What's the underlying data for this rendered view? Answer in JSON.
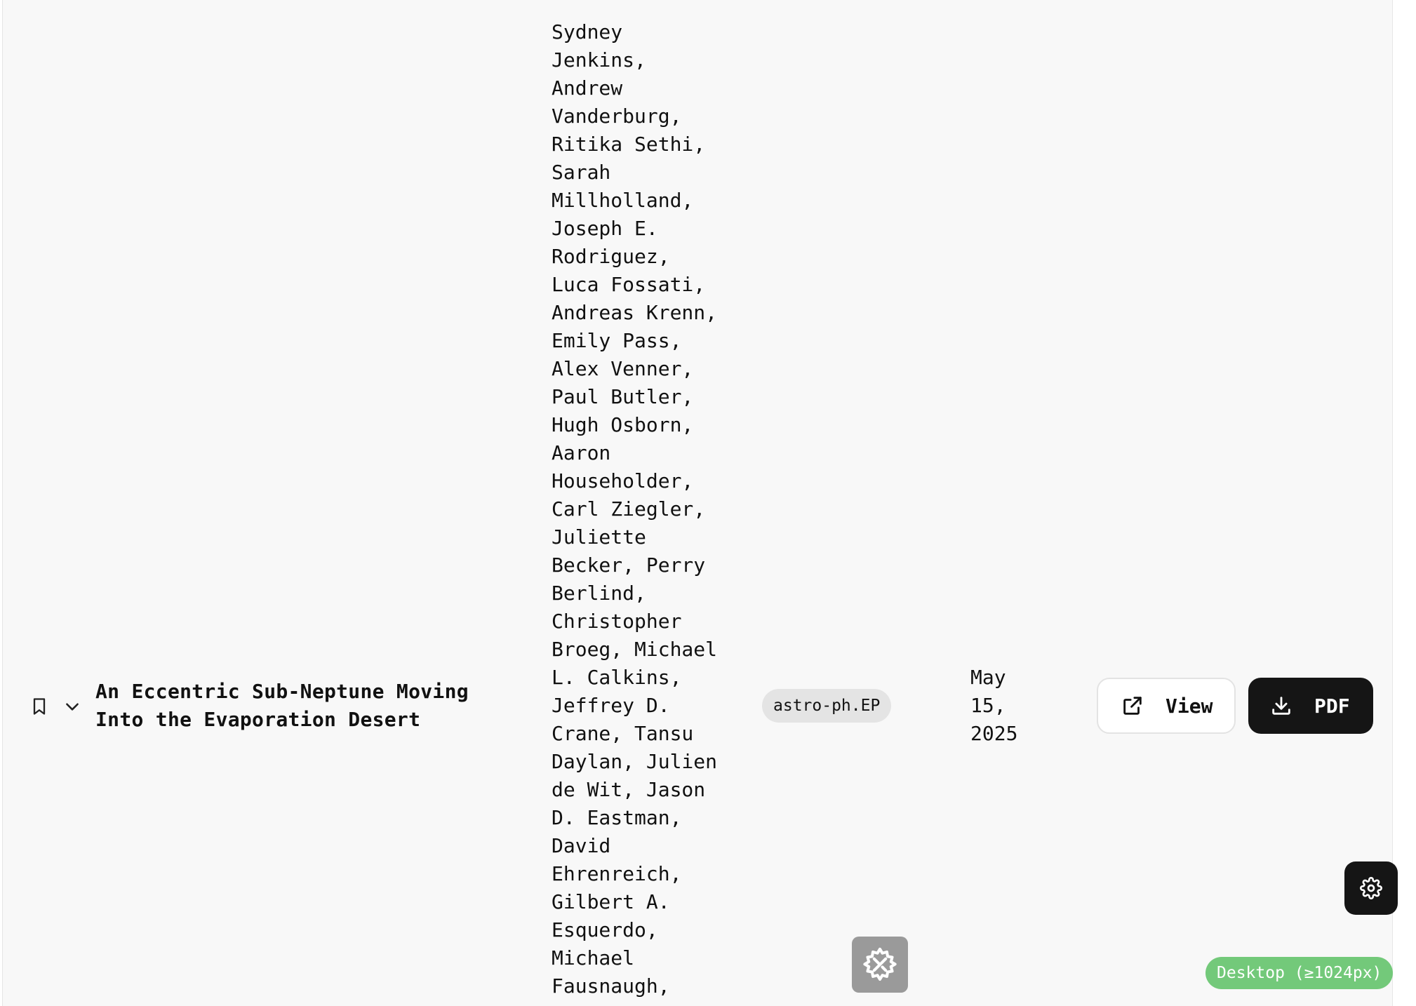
{
  "paper": {
    "title": "An Eccentric Sub-Neptune Moving Into the Evaporation Desert",
    "authors": "Sydney Jenkins, Andrew Vanderburg, Ritika Sethi, Sarah Millholland, Joseph E. Rodriguez, Luca Fossati, Andreas Krenn, Emily Pass, Alex Venner, Paul Butler, Hugh Osborn, Aaron Householder, Carl Ziegler, Juliette Becker, Perry Berlind, Christopher Broeg, Michael L. Calkins, Jeffrey D. Crane, Tansu Daylan, Julien de Wit, Jason D. Eastman, David Ehrenreich, Gilbert A. Esquerdo, Michael Fausnaugh,",
    "category": "astro-ph.EP",
    "date": "May 15, 2025"
  },
  "actions": {
    "view_label": "View",
    "pdf_label": "PDF"
  },
  "viewport_badge": "Desktop (≥1024px)",
  "icons": {
    "bookmark": "bookmark-icon",
    "expand": "chevron-down-icon",
    "view": "external-link-icon",
    "pdf": "download-icon",
    "settings": "gear-icon",
    "dev_tools": "gear-wrench-icon"
  },
  "colors": {
    "panel_background": "#f8f8f8",
    "primary_button": "#151515",
    "category_chip": "#e4e4e4",
    "viewport_badge": "#73c97a",
    "dev_tools_button": "#9a9a9a"
  }
}
